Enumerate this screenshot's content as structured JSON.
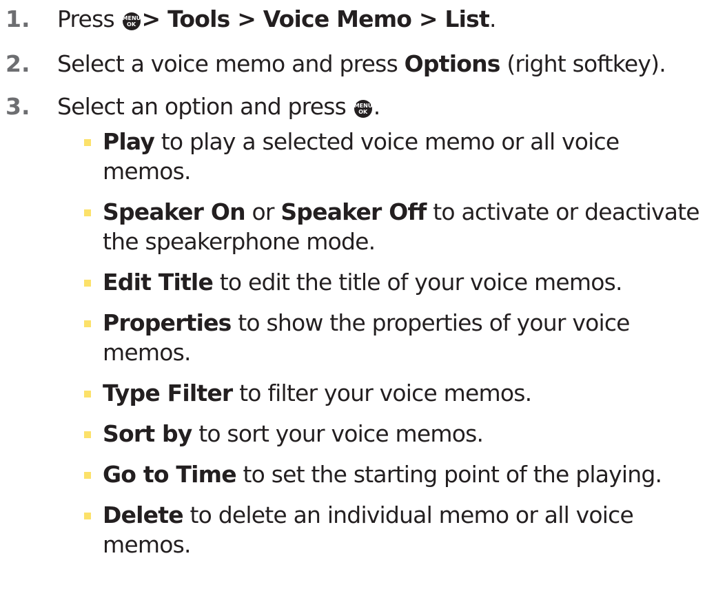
{
  "steps": [
    {
      "number": "1.",
      "parts": {
        "pre": "Press ",
        "path": "> Tools > Voice Memo > List",
        "post": "."
      }
    },
    {
      "number": "2.",
      "parts": {
        "pre": "Select a voice memo and press ",
        "bold": "Options",
        "post": " (right softkey)."
      }
    },
    {
      "number": "3.",
      "parts": {
        "pre": "Select an option and press ",
        "post": "."
      }
    }
  ],
  "menu_key": {
    "line1": "MENU",
    "line2": "OK",
    "icon": "menu-ok-key-icon"
  },
  "options": [
    {
      "bold": "Play",
      "text": " to play a selected voice memo or all voice memos."
    },
    {
      "bold": "Speaker On",
      "mid": " or ",
      "bold2": "Speaker Off",
      "text": " to activate or deactivate the speakerphone mode."
    },
    {
      "bold": "Edit Title",
      "text": " to edit the title of your voice memos."
    },
    {
      "bold": "Properties",
      "text": " to show the properties of your voice memos."
    },
    {
      "bold": "Type Filter",
      "text": " to filter your voice memos."
    },
    {
      "bold": "Sort by",
      "text": " to sort your voice memos."
    },
    {
      "bold": "Go to Time",
      "text": " to set the starting point of the playing."
    },
    {
      "bold": "Delete",
      "text": " to delete an individual memo or all voice memos."
    }
  ],
  "colors": {
    "text": "#231f20",
    "step_number": "#6d6e71",
    "bullet": "#fce16a"
  }
}
